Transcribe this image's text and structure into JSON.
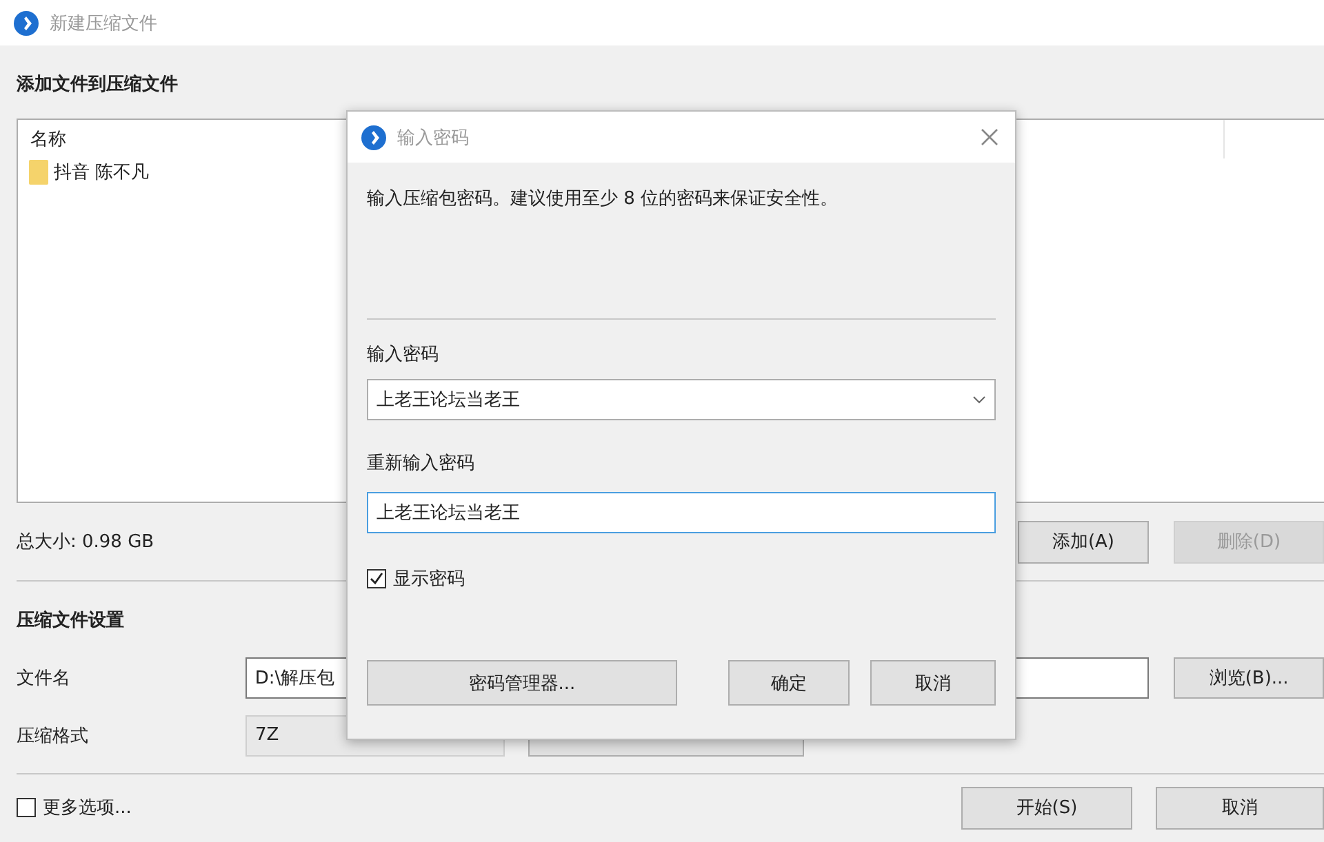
{
  "window": {
    "title": "新建压缩文件"
  },
  "add_section": {
    "heading": "添加文件到压缩文件",
    "list": {
      "columns": [
        "名称"
      ],
      "items": [
        {
          "name": "抖音 陈不凡",
          "kind": "folder"
        }
      ]
    },
    "total_size": "总大小: 0.98 GB",
    "buttons": [
      {
        "label": "添加(A)",
        "disabled": false
      },
      {
        "label": "删除(D)",
        "disabled": true
      }
    ]
  },
  "settings": {
    "heading": "压缩文件设置",
    "filename": {
      "label": "文件名",
      "value": "D:\\解压包"
    },
    "browse_button": "浏览(B)...",
    "format": {
      "label": "压缩格式",
      "value": "7Z"
    }
  },
  "more_options": {
    "label": "更多选项...",
    "checked": false
  },
  "footer_buttons": [
    "开始(S)",
    "取消"
  ],
  "dialog": {
    "title": "输入密码",
    "message": "输入压缩包密码。建议使用至少 8 位的密码来保证安全性。",
    "password_label": "输入密码",
    "password": "上老王论坛当老王",
    "confirm_label": "重新输入密码",
    "confirm": "上老王论坛当老王",
    "show_password": {
      "label": "显示密码",
      "checked": true
    },
    "manager_button": "密码管理器...",
    "buttons": [
      "确定",
      "取消"
    ]
  }
}
